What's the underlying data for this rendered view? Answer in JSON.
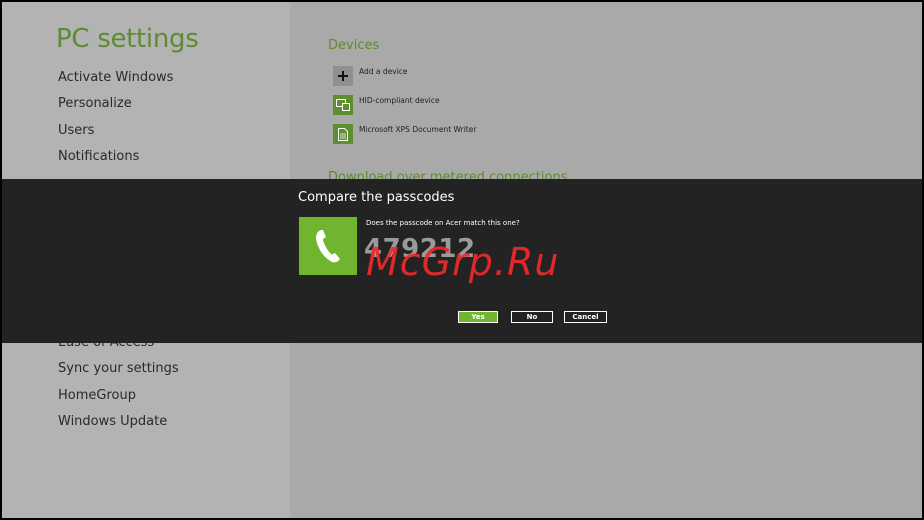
{
  "app": {
    "title": "PC settings"
  },
  "nav": {
    "top_items": [
      {
        "label": "Activate Windows"
      },
      {
        "label": "Personalize"
      },
      {
        "label": "Users"
      },
      {
        "label": "Notifications"
      }
    ],
    "bottom_items": [
      {
        "label": "Ease of Access"
      },
      {
        "label": "Sync your settings"
      },
      {
        "label": "HomeGroup"
      },
      {
        "label": "Windows Update"
      }
    ]
  },
  "devices": {
    "title": "Devices",
    "items": [
      {
        "label": "Add a device",
        "icon": "plus-icon"
      },
      {
        "label": "HID-compliant device",
        "icon": "device-icon"
      },
      {
        "label": "Microsoft XPS Document Writer",
        "icon": "printer-document-icon"
      }
    ],
    "metered_title": "Download over metered connections"
  },
  "dialog": {
    "title": "Compare the passcodes",
    "question": "Does the passcode on Acer match this one?",
    "passcode": "479212",
    "icon": "phone-icon",
    "yes_label": "Yes",
    "no_label": "No",
    "cancel_label": "Cancel"
  },
  "watermark": {
    "text": "McGrp.Ru"
  },
  "colors": {
    "accent_green": "#6fb62e",
    "title_green": "#5d8b32",
    "dialog_bg": "#232323",
    "left_pane": "#b3b3b3",
    "right_pane": "#a9a9a9"
  }
}
